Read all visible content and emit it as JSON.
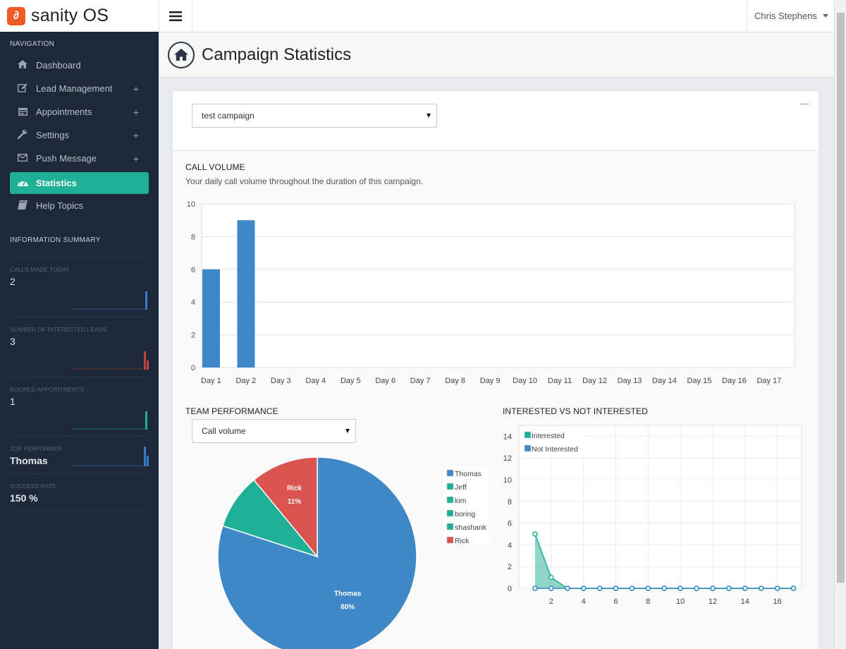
{
  "brand": {
    "name": "sanity OS",
    "logo_glyph": "∂"
  },
  "topbar": {
    "user_name": "Chris Stephens"
  },
  "sidebar": {
    "nav_heading": "NAVIGATION",
    "items": [
      {
        "label": "Dashboard",
        "icon": "home-icon",
        "has_submenu": false
      },
      {
        "label": "Lead Management",
        "icon": "edit-icon",
        "has_submenu": true
      },
      {
        "label": "Appointments",
        "icon": "calendar-icon",
        "has_submenu": true
      },
      {
        "label": "Settings",
        "icon": "wrench-icon",
        "has_submenu": true
      },
      {
        "label": "Push Message",
        "icon": "envelope-icon",
        "has_submenu": true
      },
      {
        "label": "Statistics",
        "icon": "dashboard-icon",
        "active": true,
        "has_submenu": false
      },
      {
        "label": "Help Topics",
        "icon": "book-icon",
        "has_submenu": false
      }
    ],
    "plus_symbol": "+",
    "summary_heading": "INFORMATION SUMMARY",
    "summary": [
      {
        "label": "CALLS MADE TODAY",
        "value": "2",
        "spark_color": "#3a7dc9"
      },
      {
        "label": "NUMBER OF INTERESTED LEADS",
        "value": "3",
        "spark_color": "#c0443f"
      },
      {
        "label": "BOOKED APPOINTMENTS",
        "value": "1",
        "spark_color": "#1fae96"
      },
      {
        "label": "TOP PERFORMER",
        "value": "Thomas",
        "spark_color": "#3a7dc9"
      },
      {
        "label": "SUCCESS RATE",
        "value": "150 %"
      }
    ]
  },
  "page": {
    "title": "Campaign Statistics"
  },
  "campaign_select": {
    "value": "test campaign"
  },
  "call_volume": {
    "title": "CALL VOLUME",
    "subtitle": "Your daily call volume throughout the duration of this campaign."
  },
  "team_performance": {
    "title": "TEAM PERFORMANCE",
    "select_value": "Call volume"
  },
  "interest": {
    "title": "INTERESTED VS NOT INTERESTED"
  },
  "colors": {
    "accent": "#1fae96",
    "blue": "#3f88c8",
    "red": "#d9534f",
    "sidebar": "#1d2939"
  },
  "chart_data": [
    {
      "type": "bar",
      "title": "CALL VOLUME",
      "categories": [
        "Day 1",
        "Day 2",
        "Day 3",
        "Day 4",
        "Day 5",
        "Day 6",
        "Day 7",
        "Day 8",
        "Day 9",
        "Day 10",
        "Day 11",
        "Day 12",
        "Day 13",
        "Day 14",
        "Day 15",
        "Day 16",
        "Day 17"
      ],
      "values": [
        6,
        9,
        0,
        0,
        0,
        0,
        0,
        0,
        0,
        0,
        0,
        0,
        0,
        0,
        0,
        0,
        0
      ],
      "ylim": [
        0,
        10
      ],
      "yticks": [
        0,
        2,
        4,
        6,
        8,
        10
      ],
      "color": "#3f88c8",
      "grid": true
    },
    {
      "type": "pie",
      "title": "TEAM PERFORMANCE",
      "slices": [
        {
          "name": "Thomas",
          "value": 80,
          "label": "80%",
          "color": "#3f88c8"
        },
        {
          "name": "Jeff",
          "value": 0,
          "color": "#1fae96"
        },
        {
          "name": "kim",
          "value": 0,
          "color": "#1fae96"
        },
        {
          "name": "boring",
          "value": 0,
          "color": "#1fae96"
        },
        {
          "name": "shashank",
          "value": 9,
          "color": "#1fae96"
        },
        {
          "name": "Rick",
          "value": 11,
          "label": "11%",
          "color": "#d9534f"
        }
      ],
      "legend_position": "right"
    },
    {
      "type": "area",
      "title": "INTERESTED VS NOT INTERESTED",
      "x": [
        1,
        2,
        3,
        4,
        5,
        6,
        7,
        8,
        9,
        10,
        11,
        12,
        13,
        14,
        15,
        16,
        17
      ],
      "series": [
        {
          "name": "Interested",
          "color": "#1fae96",
          "values": [
            5,
            1,
            0,
            0,
            0,
            0,
            0,
            0,
            0,
            0,
            0,
            0,
            0,
            0,
            0,
            0,
            0
          ]
        },
        {
          "name": "Not Interested",
          "color": "#3f88c8",
          "values": [
            0,
            0,
            0,
            0,
            0,
            0,
            0,
            0,
            0,
            0,
            0,
            0,
            0,
            0,
            0,
            0,
            0
          ]
        }
      ],
      "xlim": [
        0,
        17.5
      ],
      "ylim": [
        0,
        15
      ],
      "xticks": [
        2,
        4,
        6,
        8,
        10,
        12,
        14,
        16
      ],
      "yticks": [
        0,
        2,
        4,
        6,
        8,
        10,
        12,
        14
      ],
      "legend_position": "top-left",
      "grid": true
    }
  ]
}
